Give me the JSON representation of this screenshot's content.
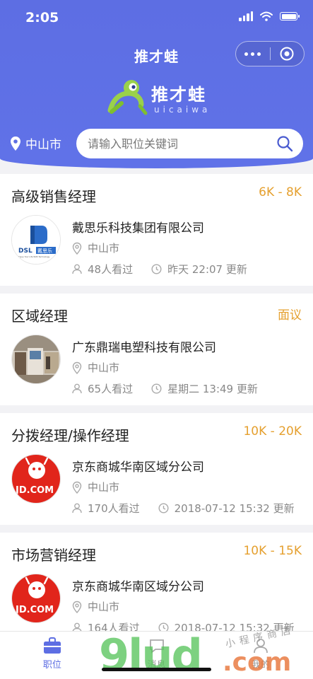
{
  "status_bar": {
    "time": "2:05"
  },
  "nav": {
    "title": "推才蛙"
  },
  "brand": {
    "name": "推才蛙",
    "sub": "uicaiwa",
    "accent": "#5d6ee3",
    "salary_color": "#e5a02f"
  },
  "location": {
    "city": "中山市"
  },
  "search": {
    "placeholder": "请输入职位关键词"
  },
  "jobs": [
    {
      "title": "高级销售经理",
      "salary": "6K - 8K",
      "company": "戴思乐科技集团有限公司",
      "location": "中山市",
      "views": "48人看过",
      "updated": "昨天 22:07 更新",
      "logo": "dsl-logo"
    },
    {
      "title": "区域经理",
      "salary": "面议",
      "company": "广东鼎瑞电塑科技有限公司",
      "location": "中山市",
      "views": "65人看过",
      "updated": "星期二 13:49 更新",
      "logo": "showroom-photo"
    },
    {
      "title": "分拨经理/操作经理",
      "salary": "10K - 20K",
      "company": "京东商城华南区域分公司",
      "location": "中山市",
      "views": "170人看过",
      "updated": "2018-07-12 15:32 更新",
      "logo": "jd-logo"
    },
    {
      "title": "市场营销经理",
      "salary": "10K - 15K",
      "company": "京东商城华南区域分公司",
      "location": "中山市",
      "views": "164人看过",
      "updated": "2018-07-12 15:32 更新",
      "logo": "jd-logo"
    }
  ],
  "logos": {
    "dsl": {
      "text": "DSL",
      "cn": "戴思乐",
      "small": "Enjoy Your Life With Technology"
    },
    "jd": {
      "text": "JD.COM"
    }
  },
  "tabbar": {
    "tabs": [
      {
        "label": "职位",
        "active": true
      },
      {
        "label": "消息"
      },
      {
        "label": "我的"
      }
    ]
  },
  "watermark": {
    "main": "9lud",
    "sub": ".com",
    "cn": "小程序商店"
  }
}
